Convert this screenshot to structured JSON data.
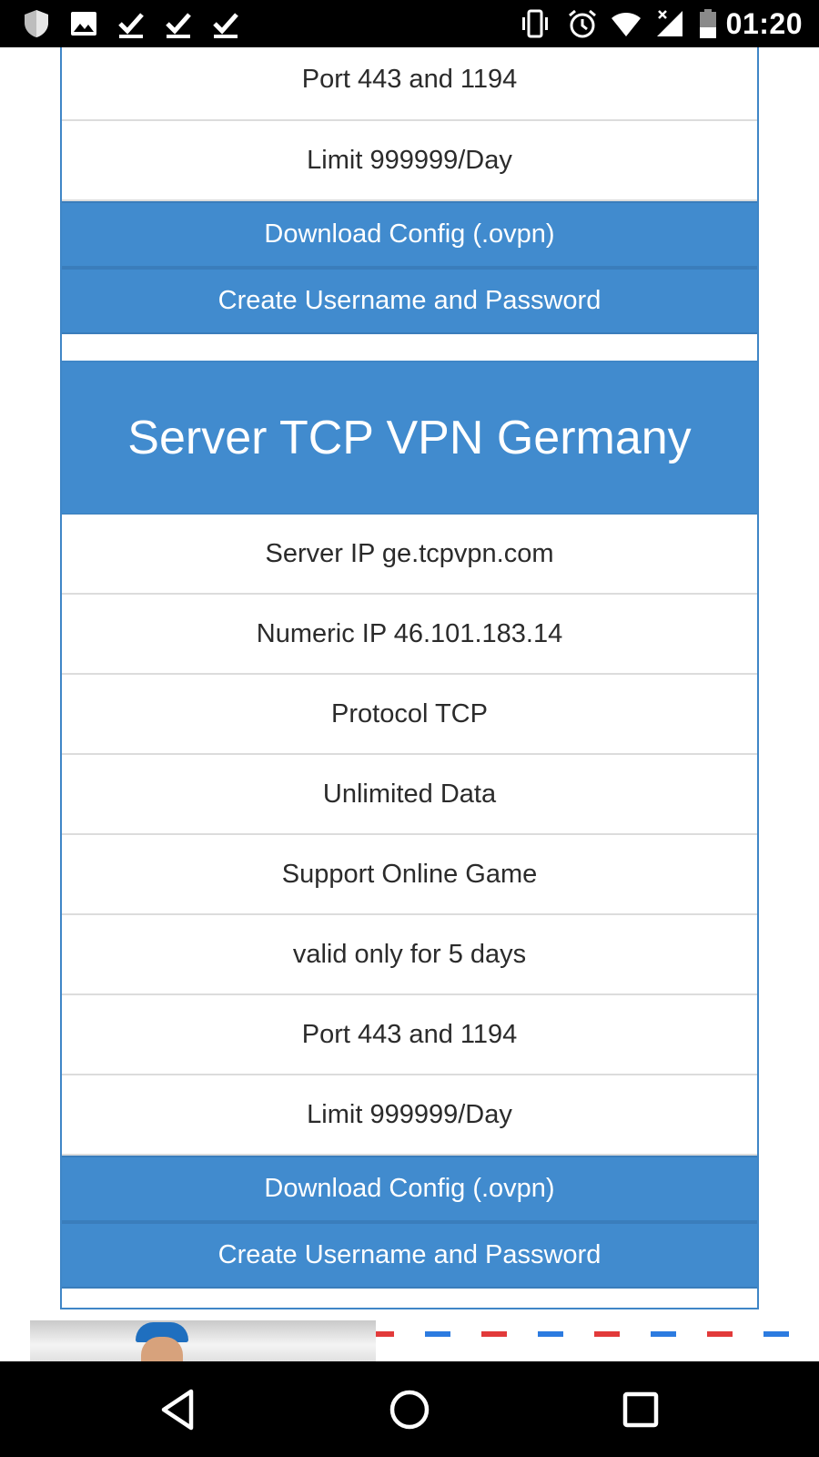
{
  "status_bar": {
    "time": "01:20",
    "left_icons": [
      "shield-icon",
      "image-icon",
      "download-done-icon",
      "download-done-icon",
      "download-done-icon"
    ],
    "right_icons": [
      "vibrate-icon",
      "alarm-icon",
      "wifi-icon",
      "signal-no-data-icon",
      "battery-icon"
    ]
  },
  "top_card": {
    "rows": [
      {
        "label": "Port 443 and 1194"
      },
      {
        "label": "Limit 999999/Day"
      }
    ],
    "buttons": {
      "download": "Download Config (.ovpn)",
      "create": "Create Username and Password"
    }
  },
  "germany_card": {
    "title": "Server TCP VPN Germany",
    "rows": [
      {
        "label": "Server IP ge.tcpvpn.com"
      },
      {
        "label": "Numeric IP 46.101.183.14"
      },
      {
        "label": "Protocol TCP"
      },
      {
        "label": "Unlimited Data"
      },
      {
        "label": "Support Online Game"
      },
      {
        "label": "valid only for 5 days"
      },
      {
        "label": "Port 443 and 1194"
      },
      {
        "label": "Limit 999999/Day"
      }
    ],
    "buttons": {
      "download": "Download Config (.ovpn)",
      "create": "Create Username and Password"
    }
  },
  "ad": {
    "dash_colors": [
      "#e23a3a",
      "#2c7be0"
    ]
  },
  "nav_bar": {
    "buttons": [
      "back-icon",
      "home-icon",
      "recents-icon"
    ]
  },
  "colors": {
    "accent": "#418bce",
    "border": "#3f86c7",
    "divider": "#dcdcdc",
    "text": "#2b2b2b"
  }
}
